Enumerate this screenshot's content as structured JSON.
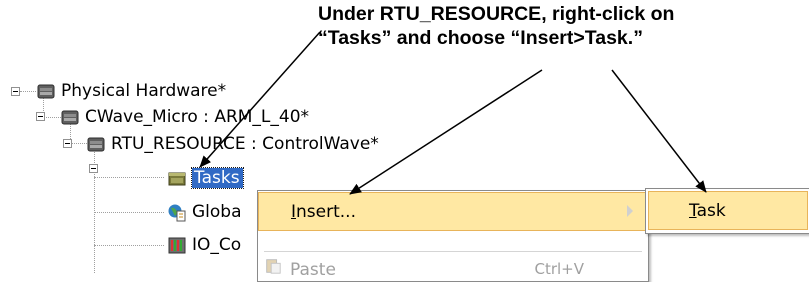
{
  "annotation": {
    "line1": "Under RTU_RESOURCE, right-click on",
    "line2": "“Tasks” and choose “Insert>Task.”"
  },
  "tree": {
    "items": [
      {
        "label": "Physical Hardware*",
        "icon": "folder-hardware-icon"
      },
      {
        "label": "CWave_Micro : ARM_L_40*",
        "icon": "folder-hardware-icon"
      },
      {
        "label": "RTU_RESOURCE : ControlWave*",
        "icon": "folder-hardware-icon"
      },
      {
        "label": "Tasks",
        "icon": "tasks-folder-icon",
        "selected": true
      },
      {
        "label": "Globa",
        "icon": "global-variables-icon"
      },
      {
        "label": "IO_Co",
        "icon": "io-configuration-icon"
      }
    ]
  },
  "context_menu": {
    "items": [
      {
        "label": "Insert...",
        "submenu": true,
        "highlighted": true
      },
      {
        "label": "Paste",
        "shortcut": "Ctrl+V",
        "disabled": true,
        "icon": "paste-icon"
      }
    ]
  },
  "submenu": {
    "items": [
      {
        "label": "Task",
        "highlighted": true
      }
    ]
  },
  "colors": {
    "selection": "#316ac5",
    "menu_highlight": "#ffe8a3",
    "menu_highlight_border": "#e8b45a"
  }
}
